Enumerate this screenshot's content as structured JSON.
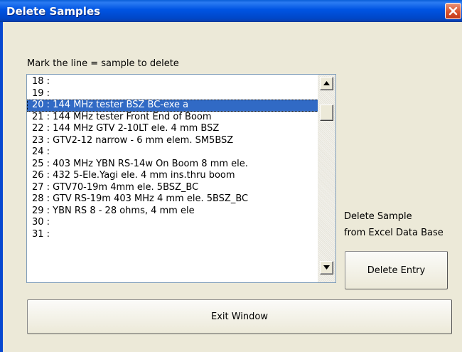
{
  "window": {
    "title": "Delete Samples"
  },
  "dialog": {
    "caption": "Mark the line = sample to delete",
    "list_items": [
      "18 :",
      "19 :",
      "20 : 144 MHz tester BSZ BC-exe a",
      "21 : 144 MHz tester Front End  of Boom",
      "22 : 144 MHz GTV 2-10LT ele. 4 mm BSZ",
      "23 : GTV2-12 narrow - 6 mm elem. SM5BSZ",
      "24 :",
      "25 : 403 MHz YBN RS-14w On Boom 8 mm ele.",
      "26 : 432 5-Ele.Yagi  ele. 4 mm ins.thru boom",
      "27 : GTV70-19m  4mm ele. 5BSZ_BC",
      "28 : GTV RS-19m 403 MHz  4 mm ele. 5BSZ_BC",
      "29 : YBN RS 8 - 28 ohms, 4 mm ele",
      "30 :",
      "31 :"
    ],
    "selected_item": "20 : 144 MHz tester BSZ BC-exe a",
    "side_label_line1": "Delete Sample",
    "side_label_line2": "from Excel Data Base",
    "delete_button": "Delete Entry",
    "exit_button": "Exit Window"
  },
  "icons": {
    "close": "close-icon",
    "scroll_up": "arrow-up-icon",
    "scroll_down": "arrow-down-icon"
  },
  "colors": {
    "titlebar": "#0054e3",
    "selection": "#316ac5",
    "close_button": "#d9532c",
    "dialog_bg": "#ece9d8"
  }
}
